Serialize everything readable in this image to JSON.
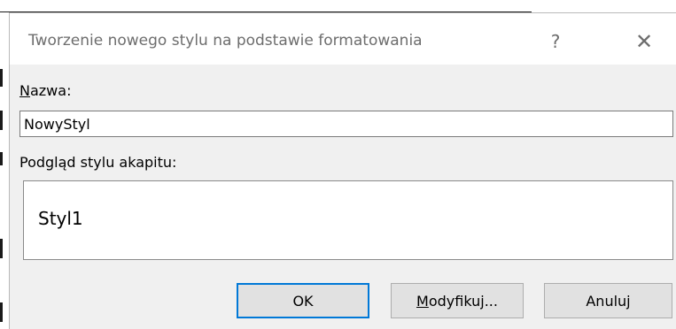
{
  "dialog": {
    "title": "Tworzenie nowego stylu na podstawie formatowania",
    "help_glyph": "?",
    "close_glyph": "✕"
  },
  "name_field": {
    "label_accel": "N",
    "label_rest": "azwa:",
    "value": "NowyStyl"
  },
  "preview": {
    "label": "Podgląd stylu akapitu:",
    "sample_text": "Styl1"
  },
  "buttons": {
    "ok": "OK",
    "modify_accel": "M",
    "modify_rest": "odyfikuj...",
    "cancel": "Anuluj"
  },
  "colors": {
    "dialog_bg": "#f0f0f0",
    "default_button_border": "#0078d7"
  }
}
